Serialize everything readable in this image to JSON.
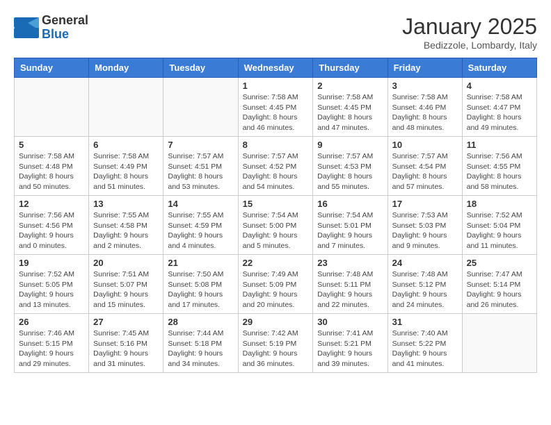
{
  "logo": {
    "general": "General",
    "blue": "Blue"
  },
  "title": "January 2025",
  "subtitle": "Bedizzole, Lombardy, Italy",
  "days_of_week": [
    "Sunday",
    "Monday",
    "Tuesday",
    "Wednesday",
    "Thursday",
    "Friday",
    "Saturday"
  ],
  "weeks": [
    [
      {
        "day": "",
        "info": ""
      },
      {
        "day": "",
        "info": ""
      },
      {
        "day": "",
        "info": ""
      },
      {
        "day": "1",
        "info": "Sunrise: 7:58 AM\nSunset: 4:45 PM\nDaylight: 8 hours\nand 46 minutes."
      },
      {
        "day": "2",
        "info": "Sunrise: 7:58 AM\nSunset: 4:45 PM\nDaylight: 8 hours\nand 47 minutes."
      },
      {
        "day": "3",
        "info": "Sunrise: 7:58 AM\nSunset: 4:46 PM\nDaylight: 8 hours\nand 48 minutes."
      },
      {
        "day": "4",
        "info": "Sunrise: 7:58 AM\nSunset: 4:47 PM\nDaylight: 8 hours\nand 49 minutes."
      }
    ],
    [
      {
        "day": "5",
        "info": "Sunrise: 7:58 AM\nSunset: 4:48 PM\nDaylight: 8 hours\nand 50 minutes."
      },
      {
        "day": "6",
        "info": "Sunrise: 7:58 AM\nSunset: 4:49 PM\nDaylight: 8 hours\nand 51 minutes."
      },
      {
        "day": "7",
        "info": "Sunrise: 7:57 AM\nSunset: 4:51 PM\nDaylight: 8 hours\nand 53 minutes."
      },
      {
        "day": "8",
        "info": "Sunrise: 7:57 AM\nSunset: 4:52 PM\nDaylight: 8 hours\nand 54 minutes."
      },
      {
        "day": "9",
        "info": "Sunrise: 7:57 AM\nSunset: 4:53 PM\nDaylight: 8 hours\nand 55 minutes."
      },
      {
        "day": "10",
        "info": "Sunrise: 7:57 AM\nSunset: 4:54 PM\nDaylight: 8 hours\nand 57 minutes."
      },
      {
        "day": "11",
        "info": "Sunrise: 7:56 AM\nSunset: 4:55 PM\nDaylight: 8 hours\nand 58 minutes."
      }
    ],
    [
      {
        "day": "12",
        "info": "Sunrise: 7:56 AM\nSunset: 4:56 PM\nDaylight: 9 hours\nand 0 minutes."
      },
      {
        "day": "13",
        "info": "Sunrise: 7:55 AM\nSunset: 4:58 PM\nDaylight: 9 hours\nand 2 minutes."
      },
      {
        "day": "14",
        "info": "Sunrise: 7:55 AM\nSunset: 4:59 PM\nDaylight: 9 hours\nand 4 minutes."
      },
      {
        "day": "15",
        "info": "Sunrise: 7:54 AM\nSunset: 5:00 PM\nDaylight: 9 hours\nand 5 minutes."
      },
      {
        "day": "16",
        "info": "Sunrise: 7:54 AM\nSunset: 5:01 PM\nDaylight: 9 hours\nand 7 minutes."
      },
      {
        "day": "17",
        "info": "Sunrise: 7:53 AM\nSunset: 5:03 PM\nDaylight: 9 hours\nand 9 minutes."
      },
      {
        "day": "18",
        "info": "Sunrise: 7:52 AM\nSunset: 5:04 PM\nDaylight: 9 hours\nand 11 minutes."
      }
    ],
    [
      {
        "day": "19",
        "info": "Sunrise: 7:52 AM\nSunset: 5:05 PM\nDaylight: 9 hours\nand 13 minutes."
      },
      {
        "day": "20",
        "info": "Sunrise: 7:51 AM\nSunset: 5:07 PM\nDaylight: 9 hours\nand 15 minutes."
      },
      {
        "day": "21",
        "info": "Sunrise: 7:50 AM\nSunset: 5:08 PM\nDaylight: 9 hours\nand 17 minutes."
      },
      {
        "day": "22",
        "info": "Sunrise: 7:49 AM\nSunset: 5:09 PM\nDaylight: 9 hours\nand 20 minutes."
      },
      {
        "day": "23",
        "info": "Sunrise: 7:48 AM\nSunset: 5:11 PM\nDaylight: 9 hours\nand 22 minutes."
      },
      {
        "day": "24",
        "info": "Sunrise: 7:48 AM\nSunset: 5:12 PM\nDaylight: 9 hours\nand 24 minutes."
      },
      {
        "day": "25",
        "info": "Sunrise: 7:47 AM\nSunset: 5:14 PM\nDaylight: 9 hours\nand 26 minutes."
      }
    ],
    [
      {
        "day": "26",
        "info": "Sunrise: 7:46 AM\nSunset: 5:15 PM\nDaylight: 9 hours\nand 29 minutes."
      },
      {
        "day": "27",
        "info": "Sunrise: 7:45 AM\nSunset: 5:16 PM\nDaylight: 9 hours\nand 31 minutes."
      },
      {
        "day": "28",
        "info": "Sunrise: 7:44 AM\nSunset: 5:18 PM\nDaylight: 9 hours\nand 34 minutes."
      },
      {
        "day": "29",
        "info": "Sunrise: 7:42 AM\nSunset: 5:19 PM\nDaylight: 9 hours\nand 36 minutes."
      },
      {
        "day": "30",
        "info": "Sunrise: 7:41 AM\nSunset: 5:21 PM\nDaylight: 9 hours\nand 39 minutes."
      },
      {
        "day": "31",
        "info": "Sunrise: 7:40 AM\nSunset: 5:22 PM\nDaylight: 9 hours\nand 41 minutes."
      },
      {
        "day": "",
        "info": ""
      }
    ]
  ]
}
